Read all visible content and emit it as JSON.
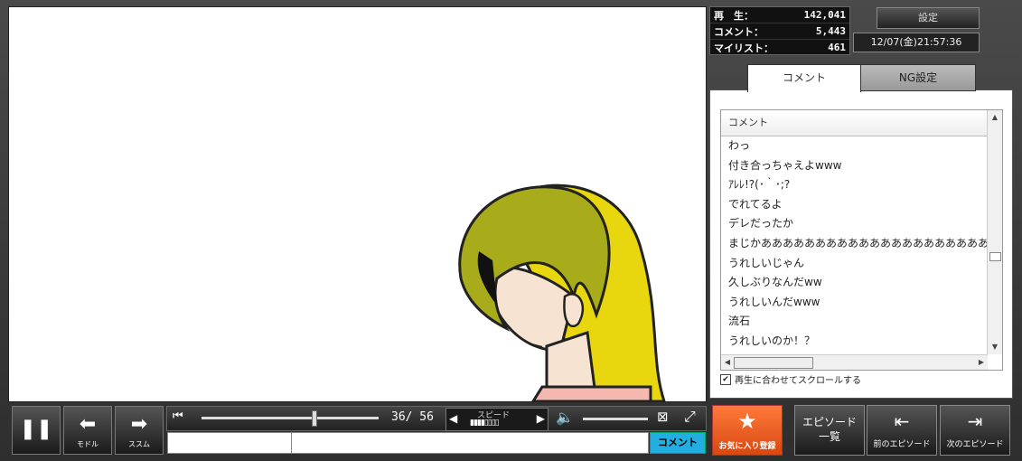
{
  "stats": {
    "play_label": "再　生：",
    "play_value": "142,041",
    "comment_label": "コメント：",
    "comment_value": "5,443",
    "mylist_label": "マイリスト：",
    "mylist_value": "461"
  },
  "header": {
    "settings_label": "設定",
    "datetime": "12/07(金)21:57:36"
  },
  "tabs": [
    {
      "label": "コメント"
    },
    {
      "label": "NG設定"
    }
  ],
  "comment_list": {
    "header": "コメント",
    "items": [
      "わっ",
      "付き合っちゃえよwww",
      "ｱﾚﾚ!?(･｀･;?",
      "でれてるよ",
      "デレだったか",
      "まじかあああああああああああああああああああああ",
      "うれしいじゃん",
      "久しぶりなんだww",
      "うれしいんだwww",
      "流石",
      "うれしいのか！？"
    ]
  },
  "sync_label": "再生に合わせてスクロールする",
  "controls": {
    "back_label": "モドル",
    "forward_label": "ススム",
    "time": "36/ 56",
    "speed_label": "スピード",
    "comment_submit": "コメント",
    "favorite_label": "お気に入り登録",
    "episode_list_label": "エピソード\n一覧",
    "prev_episode_label": "前のエピソード",
    "next_episode_label": "次のエピソード"
  },
  "colors": {
    "accent_orange": "#e85a1e",
    "submit_cyan": "#22aee0"
  }
}
